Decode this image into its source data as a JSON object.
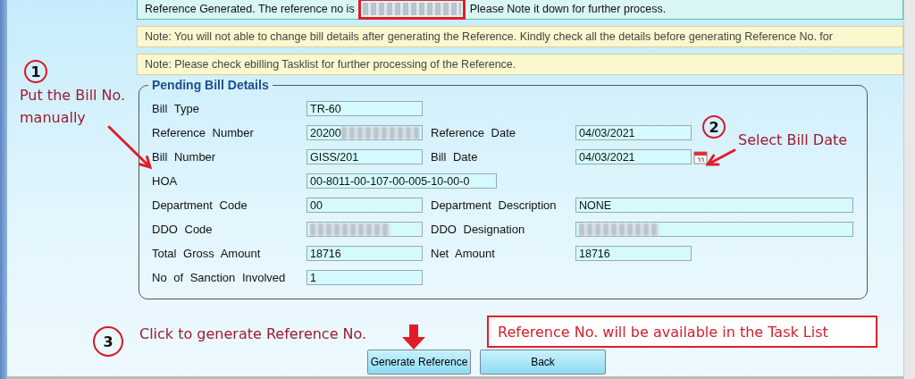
{
  "messages": [
    {
      "kind": "success",
      "text": "Reference Generated. The reference no is",
      "redacted": true,
      "highlighted": true,
      "text_after": "Please Note it down for further process."
    },
    {
      "kind": "note",
      "text": "Note: You will not able to change bill details after generating the Reference. Kindly check all the details before generating Reference No. for"
    },
    {
      "kind": "note",
      "text": "Note: Please check ebilling Tasklist for further processing of the Reference."
    }
  ],
  "form": {
    "legend": "Pending Bill Details",
    "rows": [
      {
        "cells": [
          {
            "label": "Bill Type",
            "value": "TR-60",
            "kind": "text"
          }
        ]
      },
      {
        "cells": [
          {
            "label": "Reference Number",
            "value": "20200",
            "redacted": true,
            "kind": "text"
          },
          {
            "label": "Reference Date",
            "value": "04/03/2021",
            "kind": "text"
          }
        ]
      },
      {
        "cells": [
          {
            "label": "Bill Number",
            "value": "GISS/201",
            "kind": "text"
          },
          {
            "label": "Bill Date",
            "value": "04/03/2021",
            "kind": "date"
          }
        ]
      },
      {
        "cells": [
          {
            "label": "HOA",
            "value": "00-8011-00-107-00-005-10-00-0",
            "kind": "medium"
          }
        ]
      },
      {
        "cells": [
          {
            "label": "Department Code",
            "value": "00",
            "kind": "text"
          },
          {
            "label": "Department Description",
            "value": "NONE",
            "kind": "wide"
          }
        ]
      },
      {
        "cells": [
          {
            "label": "DDO Code",
            "redacted": true,
            "kind": "text"
          },
          {
            "label": "DDO Designation",
            "redacted": true,
            "kind": "wide"
          }
        ]
      },
      {
        "cells": [
          {
            "label": "Total Gross Amount",
            "value": "18716",
            "kind": "text"
          },
          {
            "label": "Net Amount",
            "value": "18716",
            "kind": "text"
          }
        ]
      },
      {
        "cells": [
          {
            "label": "No of Sanction Involved",
            "value": "1",
            "kind": "text"
          }
        ]
      }
    ]
  },
  "buttons": [
    "Generate Reference",
    "Back"
  ],
  "annotations": [
    {
      "kind": "step",
      "number": "1",
      "text": "Put the Bill No. manually"
    },
    {
      "kind": "step",
      "number": "2",
      "text": "Select Bill Date"
    },
    {
      "kind": "step",
      "number": "3",
      "text": "Click to generate Reference No."
    },
    {
      "kind": "callout",
      "text": "Reference No. will be available in the Task List"
    }
  ]
}
